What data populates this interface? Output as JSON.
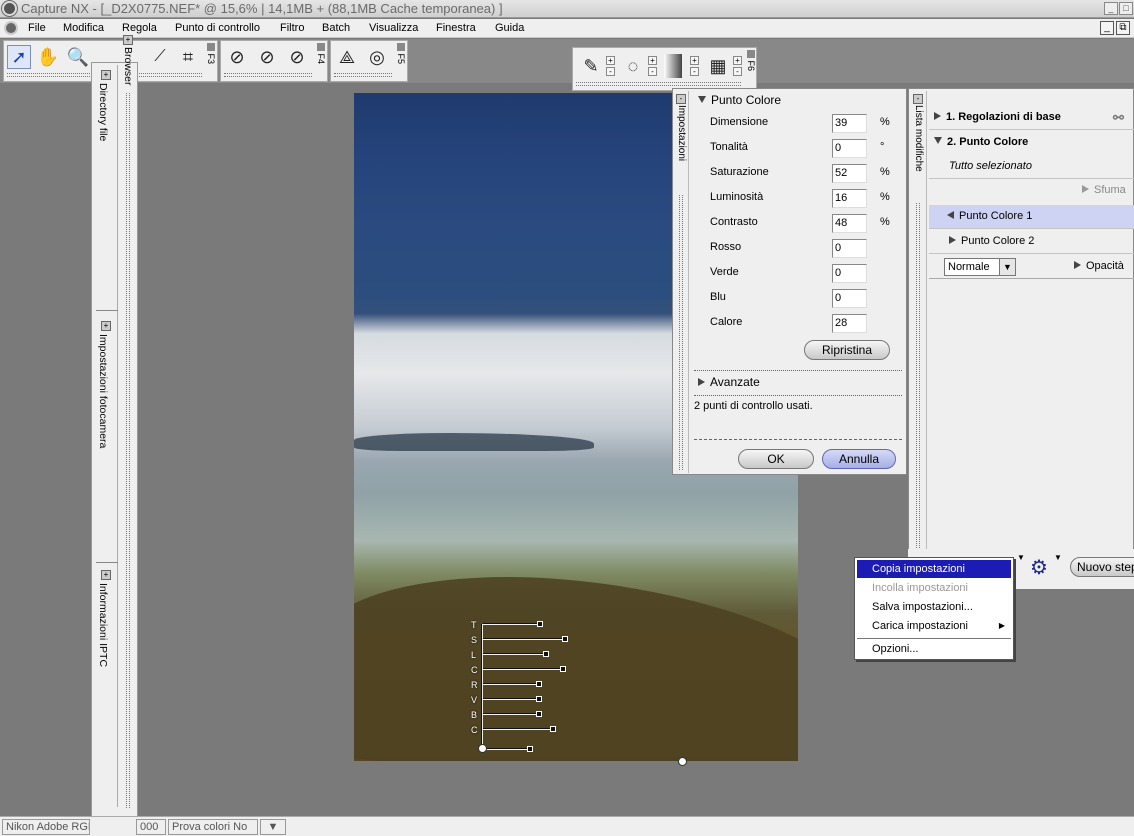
{
  "window": {
    "title": "Capture NX - [_D2X0775.NEF* @ 15,6% | 14,1MB + (88,1MB Cache temporanea) ]"
  },
  "menu": [
    "File",
    "Modifica",
    "Regola",
    "Punto di controllo",
    "Filtro",
    "Batch",
    "Visualizza",
    "Finestra",
    "Guida"
  ],
  "toolbars": {
    "f3": "F3",
    "f4": "F4",
    "f5": "F5",
    "f6": "F6"
  },
  "left_dock": {
    "directory": "Directory file",
    "camera": "Impostazioni fotocamera",
    "iptc": "Informazioni IPTC",
    "browser": "Browser"
  },
  "control_point_letters": [
    "T",
    "S",
    "L",
    "C",
    "R",
    "V",
    "B",
    "C"
  ],
  "settings_panel": {
    "strip_label": "Impostazioni",
    "heading": "Punto Colore",
    "fields": [
      {
        "label": "Dimensione",
        "value": "39",
        "unit": "%"
      },
      {
        "label": "Tonalità",
        "value": "0",
        "unit": "°"
      },
      {
        "label": "Saturazione",
        "value": "52",
        "unit": "%"
      },
      {
        "label": "Luminosità",
        "value": "16",
        "unit": "%"
      },
      {
        "label": "Contrasto",
        "value": "48",
        "unit": "%"
      },
      {
        "label": "Rosso",
        "value": "0",
        "unit": ""
      },
      {
        "label": "Verde",
        "value": "0",
        "unit": ""
      },
      {
        "label": "Blu",
        "value": "0",
        "unit": ""
      },
      {
        "label": "Calore",
        "value": "28",
        "unit": ""
      }
    ],
    "reset_label": "Ripristina",
    "advanced": "Avanzate",
    "status": "2 punti di controllo usati.",
    "ok": "OK",
    "cancel": "Annulla"
  },
  "edit_list": {
    "strip_label": "Lista modifiche",
    "step1": "1. Regolazioni di base",
    "step2": "2. Punto Colore",
    "selection": "Tutto selezionato",
    "feather": "Sfuma",
    "point1": "Punto Colore 1",
    "point2": "Punto Colore 2",
    "blend_mode": "Normale",
    "opacity": "Opacità",
    "new_step": "Nuovo step"
  },
  "context_menu": {
    "items": [
      {
        "label": "Copia impostazioni",
        "state": "highlighted"
      },
      {
        "label": "Incolla impostazioni",
        "state": "disabled"
      },
      {
        "label": "Salva impostazioni...",
        "state": "normal"
      },
      {
        "label": "Carica impostazioni",
        "state": "submenu"
      },
      {
        "label": "Opzioni...",
        "state": "normal"
      }
    ]
  },
  "statusbar": {
    "profile": "Nikon Adobe RGB",
    "zoom_fragment": "000",
    "proof": "Prova colori No"
  },
  "colors": {
    "menu_highlight": "#1c1cb4",
    "selected_row": "#cfd3f3",
    "workspace": "#7a7a7a"
  }
}
